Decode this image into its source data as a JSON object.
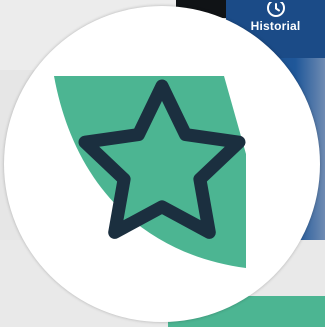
{
  "history_tab": {
    "label": "Historial",
    "icon": "clock-icon"
  },
  "favorite": {
    "icon": "star-icon"
  },
  "colors": {
    "accent_green": "#4cb592",
    "star_stroke": "#1b2f3f",
    "tab_blue": "#1b4b87"
  }
}
